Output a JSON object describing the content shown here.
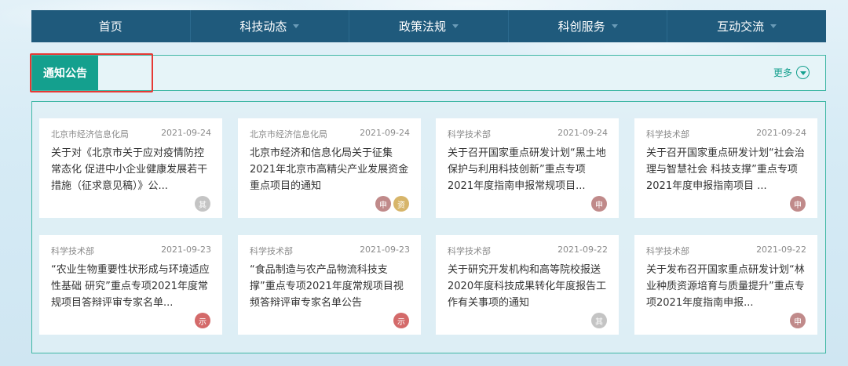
{
  "nav": {
    "items": [
      {
        "label": "首页"
      },
      {
        "label": "科技动态"
      },
      {
        "label": "政策法规"
      },
      {
        "label": "科创服务"
      },
      {
        "label": "互动交流"
      }
    ]
  },
  "section": {
    "title": "通知公告",
    "more_label": "更多"
  },
  "colors": {
    "nav_bg": "#1f5a7c",
    "accent": "#14a08e",
    "highlight_border": "#e53935",
    "tag_grey": "#c4c4c4",
    "tag_red": "#d46a6a",
    "tag_gold": "#d7b56a",
    "tag_mauve": "#c08a8a"
  },
  "cards": [
    {
      "source": "北京市经济信息化局",
      "date": "2021-09-24",
      "title": "关于对《北京市关于应对疫情防控常态化 促进中小企业健康发展若干措施（征求意见稿）》公...",
      "tags": [
        {
          "text": "其",
          "color": "#c4c4c4"
        }
      ]
    },
    {
      "source": "北京市经济信息化局",
      "date": "2021-09-24",
      "title": "北京市经济和信息化局关于征集2021年北京市高精尖产业发展资金重点项目的通知",
      "tags": [
        {
          "text": "申",
          "color": "#c08a8a"
        },
        {
          "text": "资",
          "color": "#d7b56a"
        }
      ]
    },
    {
      "source": "科学技术部",
      "date": "2021-09-24",
      "title": "关于召开国家重点研发计划“黑土地保护与利用科技创新”重点专项2021年度指南申报常规项目...",
      "tags": [
        {
          "text": "申",
          "color": "#c08a8a"
        }
      ]
    },
    {
      "source": "科学技术部",
      "date": "2021-09-24",
      "title": "关于召开国家重点研发计划“社会治理与智慧社会 科技支撑”重点专项2021年度申报指南项目 ...",
      "tags": [
        {
          "text": "申",
          "color": "#c08a8a"
        }
      ]
    },
    {
      "source": "科学技术部",
      "date": "2021-09-23",
      "title": "“农业生物重要性状形成与环境适应性基础 研究”重点专项2021年度常规项目答辩评审专家名单...",
      "tags": [
        {
          "text": "示",
          "color": "#d46a6a"
        }
      ]
    },
    {
      "source": "科学技术部",
      "date": "2021-09-23",
      "title": "“食品制造与农产品物流科技支撑”重点专项2021年度常规项目视频答辩评审专家名单公告",
      "tags": [
        {
          "text": "示",
          "color": "#d46a6a"
        }
      ]
    },
    {
      "source": "科学技术部",
      "date": "2021-09-22",
      "title": "关于研究开发机构和高等院校报送2020年度科技成果转化年度报告工作有关事项的通知",
      "tags": [
        {
          "text": "其",
          "color": "#c4c4c4"
        }
      ]
    },
    {
      "source": "科学技术部",
      "date": "2021-09-22",
      "title": "关于发布召开国家重点研发计划“林业种质资源培育与质量提升”重点专项2021年度指南申报...",
      "tags": [
        {
          "text": "申",
          "color": "#c08a8a"
        }
      ]
    }
  ]
}
